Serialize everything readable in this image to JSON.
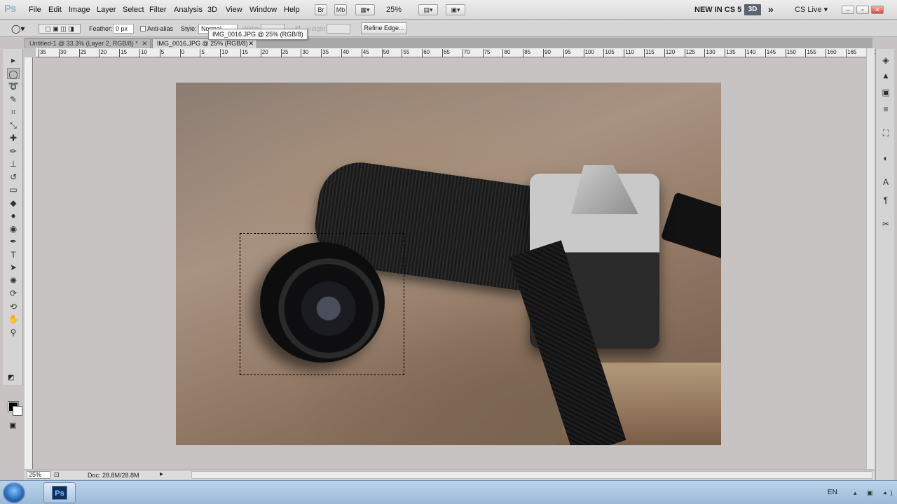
{
  "app": {
    "logo": "Ps"
  },
  "menu": [
    "File",
    "Edit",
    "Image",
    "Layer",
    "Select",
    "Filter",
    "Analysis",
    "3D",
    "View",
    "Window",
    "Help"
  ],
  "menubar_right": {
    "btn_br": "Br",
    "btn_mb": "Mb",
    "zoom": "25%",
    "new_in": "NEW IN CS 5",
    "btn_3d": "3D",
    "chevron": "»",
    "cs_live": "CS Live ▾",
    "win_min": "–",
    "win_restore": "▫",
    "win_close": "✕"
  },
  "options": {
    "feather_label": "Feather:",
    "feather_value": "0 px",
    "antialias_label": "Anti-alias",
    "style_label": "Style:",
    "style_value": "Normal",
    "width_label": "Width:",
    "height_label": "Height:",
    "refine_edge": "Refine Edge..."
  },
  "tooltip": "IMG_0016.JPG @ 25% (RGB/8)",
  "tabs": [
    {
      "label": "Untitled-1 @ 33.3% (Layer 2, RGB/8) *",
      "close": "✕"
    },
    {
      "label": "IMG_0016.JPG @ 25% (RGB/8)",
      "close": "✕"
    }
  ],
  "ruler_h_ticks": [
    "35",
    "30",
    "25",
    "20",
    "15",
    "10",
    "5",
    "0",
    "5",
    "10",
    "15",
    "20",
    "25",
    "30",
    "35",
    "40",
    "45",
    "50",
    "55",
    "60",
    "65",
    "70",
    "75",
    "80",
    "85",
    "90",
    "95",
    "100",
    "105",
    "110",
    "115",
    "120",
    "125",
    "130",
    "135",
    "140",
    "145",
    "150",
    "155",
    "160",
    "165",
    "170"
  ],
  "tools": [
    {
      "name": "move-tool-icon",
      "glyph": "▸"
    },
    {
      "name": "elliptical-marquee-icon",
      "glyph": "◯"
    },
    {
      "name": "lasso-icon",
      "glyph": "➰"
    },
    {
      "name": "quick-selection-icon",
      "glyph": "✎"
    },
    {
      "name": "crop-icon",
      "glyph": "⌗"
    },
    {
      "name": "eyedropper-icon",
      "glyph": "⤡"
    },
    {
      "name": "healing-brush-icon",
      "glyph": "✚"
    },
    {
      "name": "brush-icon",
      "glyph": "✏"
    },
    {
      "name": "clone-stamp-icon",
      "glyph": "⊥"
    },
    {
      "name": "history-brush-icon",
      "glyph": "↺"
    },
    {
      "name": "eraser-icon",
      "glyph": "▭"
    },
    {
      "name": "paint-bucket-icon",
      "glyph": "◆"
    },
    {
      "name": "blur-icon",
      "glyph": "●"
    },
    {
      "name": "dodge-icon",
      "glyph": "◉"
    },
    {
      "name": "pen-icon",
      "glyph": "✒"
    },
    {
      "name": "type-icon",
      "glyph": "T"
    },
    {
      "name": "path-selection-icon",
      "glyph": "➤"
    },
    {
      "name": "shape-icon",
      "glyph": "✺"
    },
    {
      "name": "3d-rotate-icon",
      "glyph": "⟳"
    },
    {
      "name": "3d-orbit-icon",
      "glyph": "⟲"
    },
    {
      "name": "hand-icon",
      "glyph": "✋"
    },
    {
      "name": "zoom-icon",
      "glyph": "⚲"
    }
  ],
  "dock_icons": [
    {
      "name": "layers-3d-icon",
      "glyph": "◈"
    },
    {
      "name": "mini-bridge-icon",
      "glyph": "▲"
    },
    {
      "name": "masks-icon",
      "glyph": "▣"
    },
    {
      "name": "adjustments-icon",
      "glyph": "≡"
    },
    {
      "name": "transform-icon",
      "glyph": "⛶"
    },
    {
      "name": "channels-icon",
      "glyph": "◐"
    },
    {
      "name": "character-icon",
      "glyph": "A"
    },
    {
      "name": "paragraph-icon",
      "glyph": "¶"
    },
    {
      "name": "tool-presets-icon",
      "glyph": "✂"
    }
  ],
  "status": {
    "zoom": "25%",
    "doc": "Doc: 28.8M/28.8M"
  },
  "taskbar": {
    "ps_label": "Ps",
    "lang": "EN",
    "tray": "▴ ▣ ◂)"
  }
}
